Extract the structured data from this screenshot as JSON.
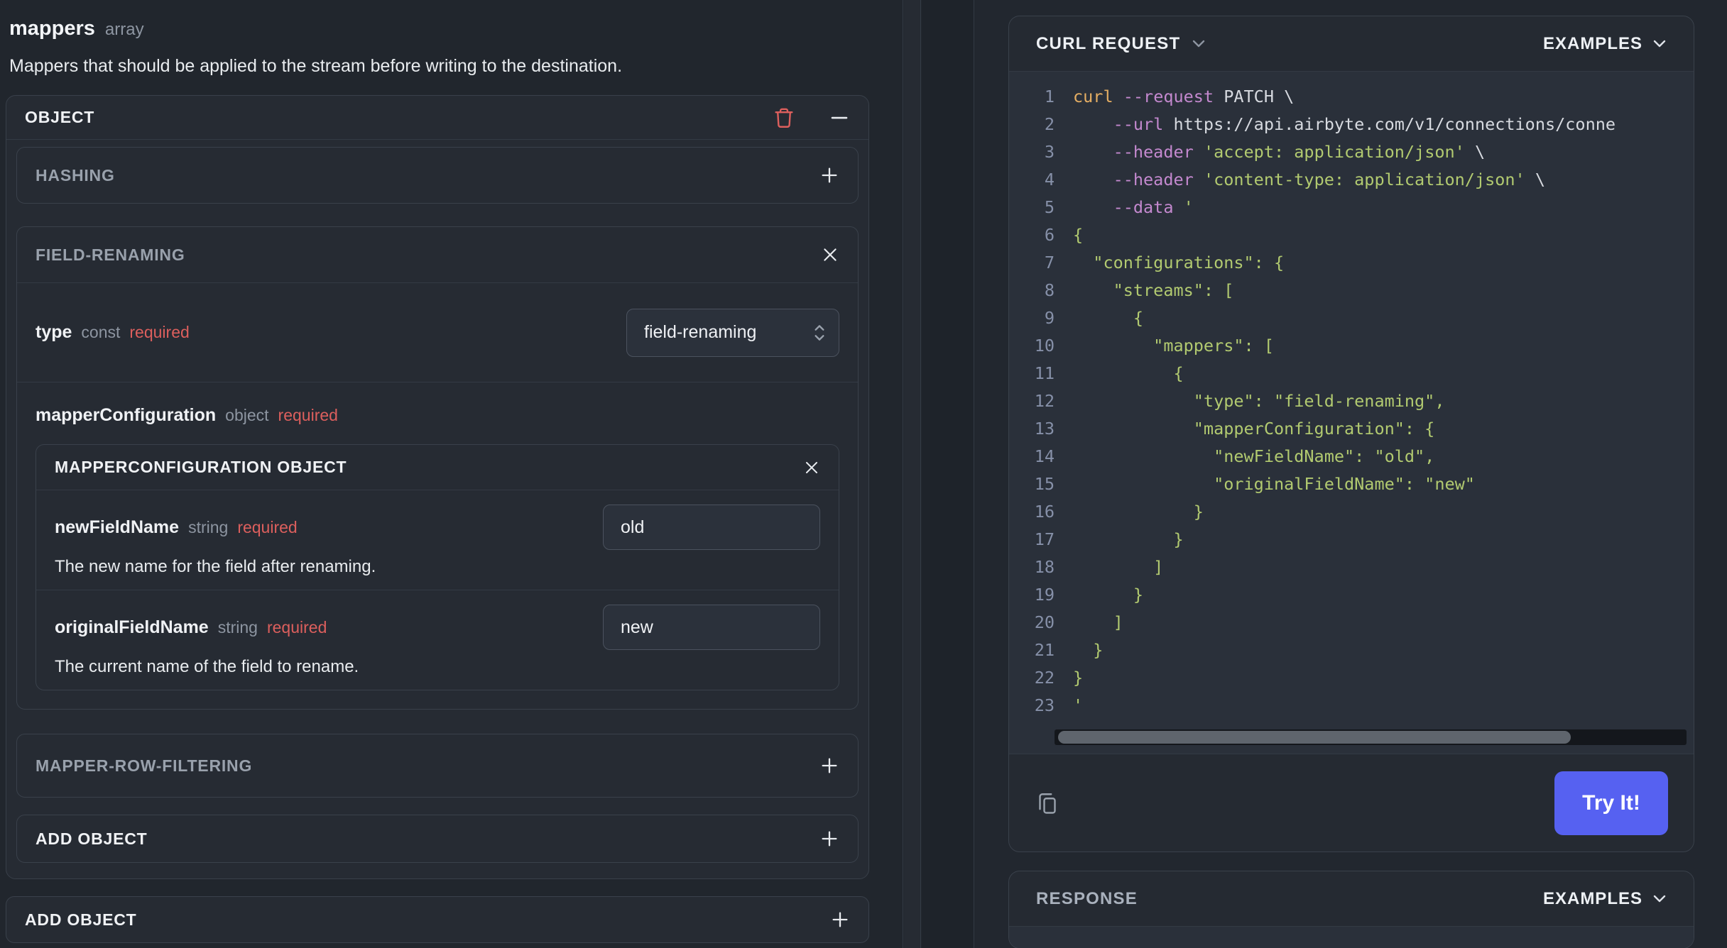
{
  "page": {
    "left": {
      "field": {
        "name": "mappers",
        "type": "array"
      },
      "description": "Mappers that should be applied to the stream before writing to the destination.",
      "object": {
        "title": "OBJECT",
        "hashing": {
          "title": "HASHING"
        },
        "field_renaming": {
          "title": "FIELD-RENAMING",
          "type_row": {
            "label": "type",
            "kind": "const",
            "required": "required",
            "value": "field-renaming"
          },
          "mapper_configuration": {
            "label": "mapperConfiguration",
            "kind": "object",
            "required": "required",
            "object_title": "MAPPERCONFIGURATION OBJECT",
            "new_field": {
              "label": "newFieldName",
              "kind": "string",
              "required": "required",
              "value": "old",
              "description": "The new name for the field after renaming."
            },
            "original_field": {
              "label": "originalFieldName",
              "kind": "string",
              "required": "required",
              "value": "new",
              "description": "The current name of the field to rename."
            }
          }
        },
        "mapper_row_filtering": {
          "title": "MAPPER-ROW-FILTERING"
        },
        "add_object": {
          "label": "ADD OBJECT"
        }
      },
      "add_object_outer": {
        "label": "ADD OBJECT"
      }
    },
    "right": {
      "curl": {
        "title": "CURL REQUEST",
        "examples_label": "EXAMPLES",
        "try_button_label": "Try It!",
        "code_lines": [
          [
            [
              "cmd",
              "curl "
            ],
            [
              "flag",
              "--request"
            ],
            [
              "plain",
              " PATCH \\"
            ]
          ],
          [
            [
              "plain",
              "    "
            ],
            [
              "flag",
              "--url"
            ],
            [
              "plain",
              " https://api.airbyte.com/v1/connections/conne"
            ]
          ],
          [
            [
              "plain",
              "    "
            ],
            [
              "flag",
              "--header"
            ],
            [
              "plain",
              " "
            ],
            [
              "str",
              "'accept: application/json'"
            ],
            [
              "plain",
              " \\"
            ]
          ],
          [
            [
              "plain",
              "    "
            ],
            [
              "flag",
              "--header"
            ],
            [
              "plain",
              " "
            ],
            [
              "str",
              "'content-type: application/json'"
            ],
            [
              "plain",
              " \\"
            ]
          ],
          [
            [
              "plain",
              "    "
            ],
            [
              "flag",
              "--data"
            ],
            [
              "plain",
              " "
            ],
            [
              "str",
              "'"
            ]
          ],
          [
            [
              "str",
              "{"
            ]
          ],
          [
            [
              "str",
              "  \"configurations\": {"
            ]
          ],
          [
            [
              "str",
              "    \"streams\": ["
            ]
          ],
          [
            [
              "str",
              "      {"
            ]
          ],
          [
            [
              "str",
              "        \"mappers\": ["
            ]
          ],
          [
            [
              "str",
              "          {"
            ]
          ],
          [
            [
              "str",
              "            \"type\": \"field-renaming\","
            ]
          ],
          [
            [
              "str",
              "            \"mapperConfiguration\": {"
            ]
          ],
          [
            [
              "str",
              "              \"newFieldName\": \"old\","
            ]
          ],
          [
            [
              "str",
              "              \"originalFieldName\": \"new\""
            ]
          ],
          [
            [
              "str",
              "            }"
            ]
          ],
          [
            [
              "str",
              "          }"
            ]
          ],
          [
            [
              "str",
              "        ]"
            ]
          ],
          [
            [
              "str",
              "      }"
            ]
          ],
          [
            [
              "str",
              "    ]"
            ]
          ],
          [
            [
              "str",
              "  }"
            ]
          ],
          [
            [
              "str",
              "}"
            ]
          ],
          [
            [
              "str",
              "'"
            ]
          ]
        ]
      },
      "response": {
        "title": "RESPONSE",
        "examples_label": "EXAMPLES"
      }
    },
    "colors": {
      "accent_button": "#5661f1",
      "required_text": "#dc5f5d",
      "code_string": "#b2ca70",
      "code_flag": "#c489cf",
      "code_command": "#e5ae63"
    }
  }
}
